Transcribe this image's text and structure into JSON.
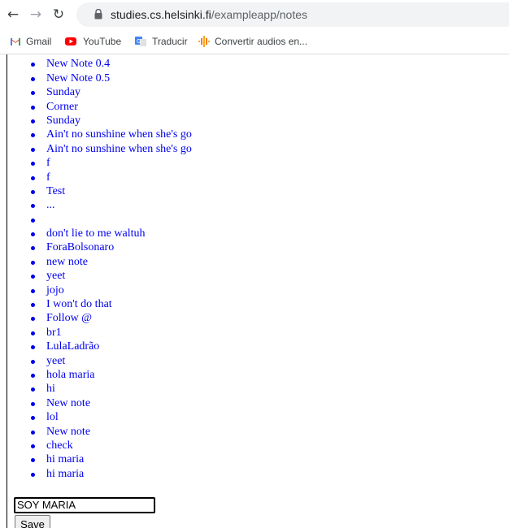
{
  "browser": {
    "url_host": "studies.cs.helsinki.fi",
    "url_path": "/exampleapp/notes",
    "bookmarks": [
      {
        "label": "Gmail",
        "icon": "gmail-icon"
      },
      {
        "label": "YouTube",
        "icon": "youtube-icon"
      },
      {
        "label": "Traducir",
        "icon": "translate-icon"
      },
      {
        "label": "Convertir audios en...",
        "icon": "audio-icon"
      }
    ]
  },
  "notes": [
    "",
    "New Note 0.4",
    "New Note 0.5",
    "Sunday",
    "Corner",
    "Sunday",
    "Ain't no sunshine when she's go",
    "Ain't no sunshine when she's go",
    "f",
    "f",
    "Test",
    "...",
    "",
    "don't lie to me waltuh",
    "ForaBolsonaro",
    "new note",
    "yeet",
    "jojo",
    "I won't do that",
    "Follow @",
    "br1",
    "LulaLadrão",
    "yeet",
    "hola maria",
    "hi",
    "New note",
    "lol",
    "New note",
    "check",
    "hi maria",
    "hi maria"
  ],
  "form": {
    "note_value": "SOY MARIA",
    "save_label": "Save"
  },
  "colors": {
    "link": "#0000ee"
  }
}
